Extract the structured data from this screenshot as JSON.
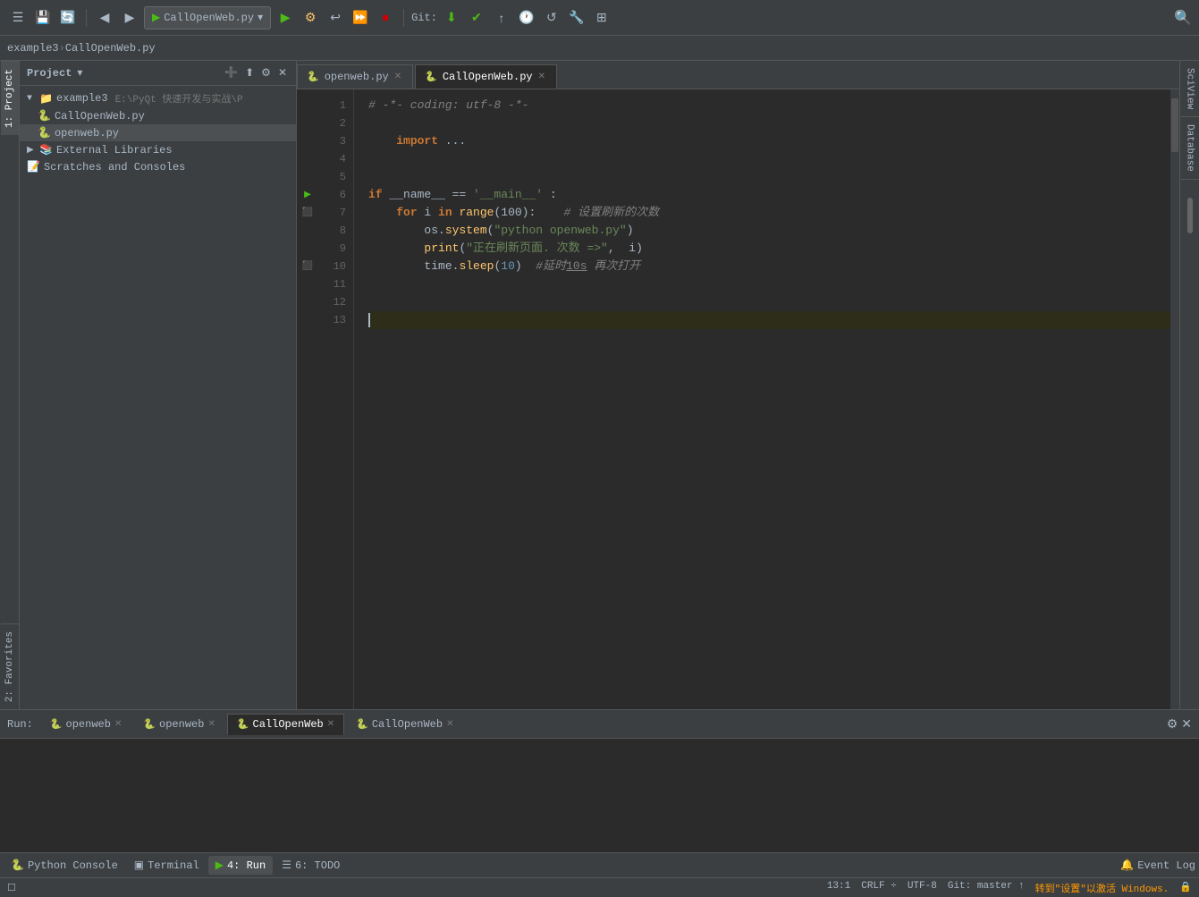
{
  "toolbar": {
    "dropdown_label": "CallOpenWeb.py",
    "git_label": "Git:",
    "search_icon": "🔍"
  },
  "breadcrumb": {
    "project": "example3",
    "separator": " › ",
    "file": "CallOpenWeb.py"
  },
  "project_panel": {
    "title": "Project",
    "root_label": "example3",
    "root_path": "E:\\PyQt 快速开发与实战\\P",
    "items": [
      {
        "label": "CallOpenWeb.py",
        "type": "py",
        "indent": 2
      },
      {
        "label": "openweb.py",
        "type": "py",
        "indent": 2,
        "selected": true
      },
      {
        "label": "External Libraries",
        "type": "lib",
        "indent": 1
      },
      {
        "label": "Scratches and Consoles",
        "type": "scratch",
        "indent": 1
      }
    ]
  },
  "editor": {
    "tabs": [
      {
        "label": "openweb.py",
        "active": false,
        "closable": true
      },
      {
        "label": "CallOpenWeb.py",
        "active": true,
        "closable": true
      }
    ],
    "lines": [
      {
        "num": 1,
        "content": "# -*- coding: utf-8 -*-",
        "type": "comment"
      },
      {
        "num": 2,
        "content": "",
        "type": "empty"
      },
      {
        "num": 3,
        "content": "    import ...",
        "type": "import"
      },
      {
        "num": 4,
        "content": "",
        "type": "empty"
      },
      {
        "num": 5,
        "content": "",
        "type": "empty"
      },
      {
        "num": 6,
        "content": "if __name__ == '__main__' :",
        "type": "if"
      },
      {
        "num": 7,
        "content": "    for i in range(100):    # 设置刷新的次数",
        "type": "for"
      },
      {
        "num": 8,
        "content": "        os.system(\"python openweb.py\")",
        "type": "call"
      },
      {
        "num": 9,
        "content": "        print(\"正在刷新页面. 次数 =>\",  i)",
        "type": "call"
      },
      {
        "num": 10,
        "content": "        time.sleep(10)   #延时10s 再次打开",
        "type": "call"
      },
      {
        "num": 11,
        "content": "",
        "type": "empty"
      },
      {
        "num": 12,
        "content": "",
        "type": "empty"
      },
      {
        "num": 13,
        "content": "",
        "type": "current"
      }
    ]
  },
  "bottom_panel": {
    "run_tabs": [
      {
        "label": "openweb",
        "closable": true
      },
      {
        "label": "openweb",
        "closable": true
      },
      {
        "label": "CallOpenWeb",
        "active": true,
        "closable": true
      },
      {
        "label": "CallOpenWeb",
        "closable": true
      }
    ],
    "run_label": "Run:"
  },
  "bottom_toolbar": {
    "items": [
      {
        "label": "Python Console",
        "icon": "🐍",
        "active": false
      },
      {
        "label": "Terminal",
        "icon": "▣",
        "active": false
      },
      {
        "label": "4: Run",
        "icon": "▶",
        "active": true
      },
      {
        "label": "6: TODO",
        "icon": "☰",
        "active": false
      }
    ],
    "event_log": "Event Log"
  },
  "status_bar": {
    "position": "13:1",
    "line_ending": "CRLF ÷",
    "encoding": "UTF-8",
    "git_branch": "Git: master ↑",
    "notifications": "🔔",
    "lock_icon": "🔒",
    "windows_msg": "转到\"设置\"以激活 Windows."
  },
  "right_sidebar": {
    "scview_label": "SciView",
    "database_label": "Database"
  }
}
